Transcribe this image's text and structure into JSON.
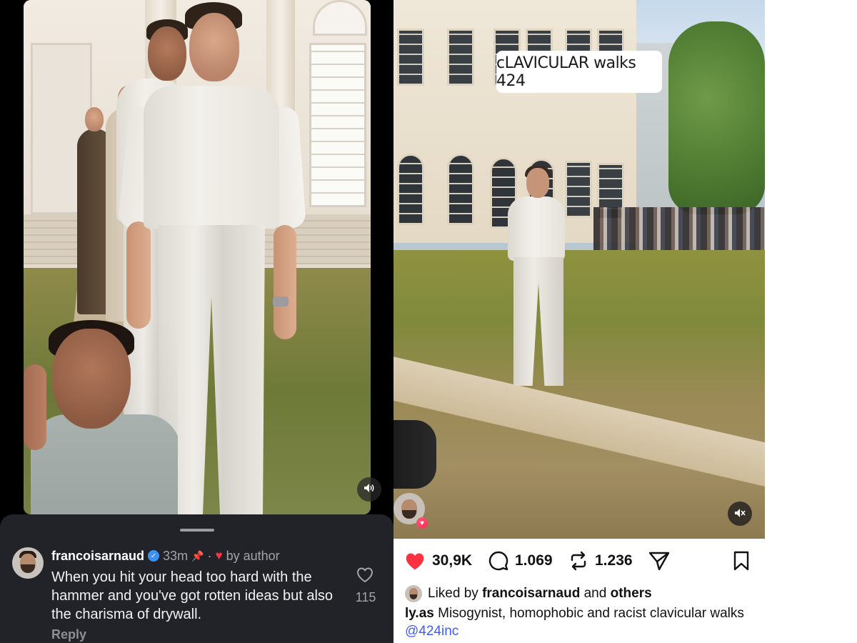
{
  "left": {
    "volume_icon": "speaker-icon",
    "comment": {
      "username": "francoisarnaud",
      "verified_icon": "verified-badge-icon",
      "time": "33m",
      "pin_icon": "pin-icon",
      "separator": "·",
      "author_like_icon": "heart-icon",
      "author_like_label": "by author",
      "text": "When you hit your head too hard with the hammer and you've got rotten ideas but also the charisma of drywall.",
      "like_count": "115",
      "reply_label": "Reply"
    }
  },
  "right": {
    "overlay_caption": "cLAVICULAR walks 424",
    "mute_icon": "muted-speaker-icon",
    "actions": {
      "likes": "30,9K",
      "comments": "1.069",
      "reposts": "1.236"
    },
    "liked_by": {
      "prefix": "Liked by",
      "user": "francoisarnaud",
      "conjunction": "and",
      "others": "others"
    },
    "caption": {
      "username": "ly.as",
      "text": " Misogynist, homophobic and racist clavicular walks ",
      "mention": "@424inc"
    }
  },
  "colors": {
    "like_red": "#ff3040",
    "verified_blue": "#3b91f5",
    "mention_blue": "#3d5afe",
    "sheet_bg": "#212328"
  }
}
